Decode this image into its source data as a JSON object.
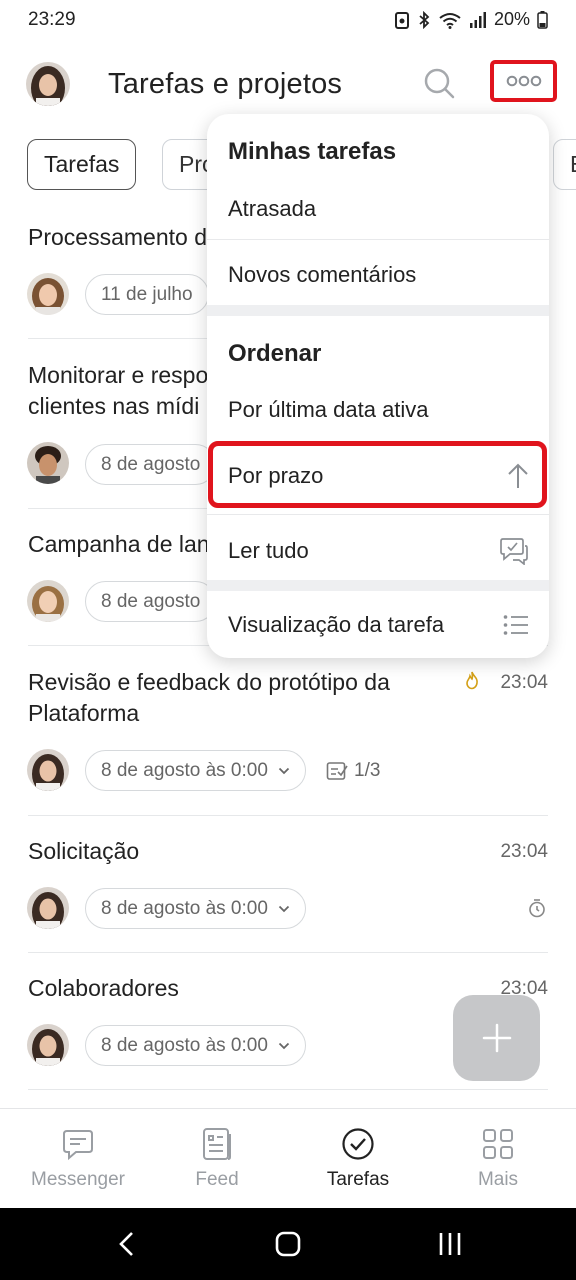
{
  "status_bar": {
    "time": "23:29",
    "battery": "20%"
  },
  "header": {
    "title": "Tarefas e projetos"
  },
  "filters": [
    {
      "label": "Tarefas",
      "active": true
    },
    {
      "label": "Pro",
      "active": false
    },
    {
      "label": "E",
      "active": false
    }
  ],
  "tasks": [
    {
      "title": "Processamento d",
      "date": "11 de julho",
      "time": ""
    },
    {
      "title": "Monitorar e respo",
      "title2": "clientes nas mídi",
      "date": "8 de agosto",
      "time": ""
    },
    {
      "title": "Campanha de lan",
      "date": "8 de agosto",
      "time": ""
    },
    {
      "title": "Revisão e feedback do protótipo da",
      "title2": "Plataforma",
      "date": "8 de agosto às 0:00",
      "time": "23:04",
      "checklist": "1/3"
    },
    {
      "title": "Solicitação",
      "date": "8 de agosto às 0:00",
      "time": "23:04"
    },
    {
      "title": "Colaboradores",
      "date": "8 de agosto às 0:00",
      "time": "23:04"
    }
  ],
  "menu": {
    "section1_title": "Minhas tarefas",
    "overdue": "Atrasada",
    "new_comments": "Novos comentários",
    "section2_title": "Ordenar",
    "by_last_active": "Por última data ativa",
    "by_deadline": "Por prazo",
    "read_all": "Ler tudo",
    "task_view": "Visualização da tarefa"
  },
  "bottom_nav": [
    {
      "label": "Messenger",
      "active": false
    },
    {
      "label": "Feed",
      "active": false
    },
    {
      "label": "Tarefas",
      "active": true
    },
    {
      "label": "Mais",
      "active": false
    }
  ],
  "colors": {
    "highlight": "#e0141d",
    "fire": "#d4a017"
  }
}
